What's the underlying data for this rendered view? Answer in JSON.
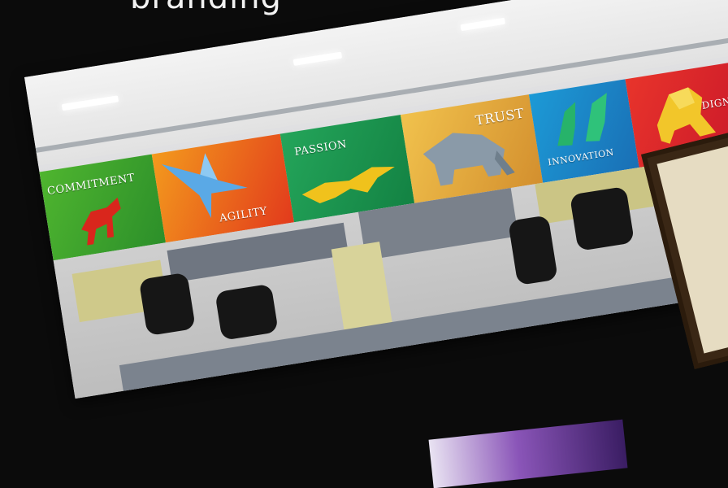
{
  "page": {
    "title": "branding"
  },
  "mural": {
    "panels": [
      {
        "label": "COMMITMENT",
        "animal": "horse",
        "color": "#3aa832"
      },
      {
        "label": "AGILITY",
        "animal": "eagle",
        "color": "#e4521e"
      },
      {
        "label": "PASSION",
        "animal": "cheetah",
        "color": "#1e9a48"
      },
      {
        "label": "TRUST",
        "animal": "elephant",
        "color": "#e0a83a"
      },
      {
        "label": "INNOVATION",
        "animal": "dolphins",
        "color": "#1a8fd1"
      },
      {
        "label": "DIGNITY",
        "animal": "lion",
        "color": "#dd1e2a"
      }
    ]
  },
  "colors": {
    "background": "#0b0b0b",
    "partition_yellow": "#cfc98a",
    "partition_gray": "#6f7681",
    "chair": "#161616"
  }
}
